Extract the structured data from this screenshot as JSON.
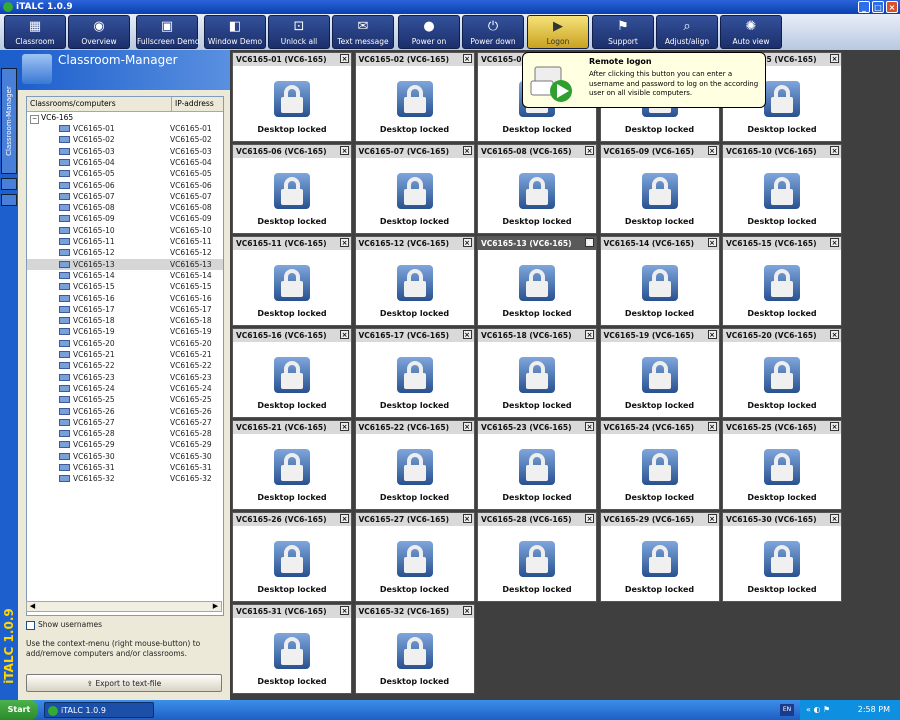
{
  "window": {
    "title": "iTALC 1.0.9"
  },
  "toolbar": {
    "buttons": [
      {
        "label": "Classroom",
        "icon": "classroom-icon",
        "glyph": "▦"
      },
      {
        "label": "Overview",
        "icon": "overview-icon",
        "glyph": "◉"
      },
      {
        "label": "Fullscreen Demo",
        "icon": "fullscreen-demo-icon",
        "glyph": "▣"
      },
      {
        "label": "Window Demo",
        "icon": "window-demo-icon",
        "glyph": "◧"
      },
      {
        "label": "Unlock all",
        "icon": "unlock-icon",
        "glyph": "⊡"
      },
      {
        "label": "Text message",
        "icon": "text-message-icon",
        "glyph": "✉"
      },
      {
        "label": "Power on",
        "icon": "power-on-icon",
        "glyph": "●"
      },
      {
        "label": "Power down",
        "icon": "power-down-icon",
        "glyph": "⏻"
      },
      {
        "label": "Logon",
        "icon": "logon-icon",
        "glyph": "▶"
      },
      {
        "label": "Support",
        "icon": "support-icon",
        "glyph": "⚑"
      },
      {
        "label": "Adjust/align",
        "icon": "adjust-icon",
        "glyph": "⌕"
      },
      {
        "label": "Auto view",
        "icon": "auto-view-icon",
        "glyph": "✺"
      }
    ],
    "active_index": 8
  },
  "leftbar": {
    "tab_label": "Classroom-Manager",
    "logo": "iTALC 1.0.9"
  },
  "panel": {
    "title": "Classroom-Manager",
    "columns": [
      "Classrooms/computers",
      "IP-address"
    ],
    "root": "VC6-165",
    "computers": [
      {
        "name": "VC6165-01",
        "ip": "VC6165-01"
      },
      {
        "name": "VC6165-02",
        "ip": "VC6165-02"
      },
      {
        "name": "VC6165-03",
        "ip": "VC6165-03"
      },
      {
        "name": "VC6165-04",
        "ip": "VC6165-04"
      },
      {
        "name": "VC6165-05",
        "ip": "VC6165-05"
      },
      {
        "name": "VC6165-06",
        "ip": "VC6165-06"
      },
      {
        "name": "VC6165-07",
        "ip": "VC6165-07"
      },
      {
        "name": "VC6165-08",
        "ip": "VC6165-08"
      },
      {
        "name": "VC6165-09",
        "ip": "VC6165-09"
      },
      {
        "name": "VC6165-10",
        "ip": "VC6165-10"
      },
      {
        "name": "VC6165-11",
        "ip": "VC6165-11"
      },
      {
        "name": "VC6165-12",
        "ip": "VC6165-12"
      },
      {
        "name": "VC6165-13",
        "ip": "VC6165-13"
      },
      {
        "name": "VC6165-14",
        "ip": "VC6165-14"
      },
      {
        "name": "VC6165-15",
        "ip": "VC6165-15"
      },
      {
        "name": "VC6165-16",
        "ip": "VC6165-16"
      },
      {
        "name": "VC6165-17",
        "ip": "VC6165-17"
      },
      {
        "name": "VC6165-18",
        "ip": "VC6165-18"
      },
      {
        "name": "VC6165-19",
        "ip": "VC6165-19"
      },
      {
        "name": "VC6165-20",
        "ip": "VC6165-20"
      },
      {
        "name": "VC6165-21",
        "ip": "VC6165-21"
      },
      {
        "name": "VC6165-22",
        "ip": "VC6165-22"
      },
      {
        "name": "VC6165-23",
        "ip": "VC6165-23"
      },
      {
        "name": "VC6165-24",
        "ip": "VC6165-24"
      },
      {
        "name": "VC6165-25",
        "ip": "VC6165-25"
      },
      {
        "name": "VC6165-26",
        "ip": "VC6165-26"
      },
      {
        "name": "VC6165-27",
        "ip": "VC6165-27"
      },
      {
        "name": "VC6165-28",
        "ip": "VC6165-28"
      },
      {
        "name": "VC6165-29",
        "ip": "VC6165-29"
      },
      {
        "name": "VC6165-30",
        "ip": "VC6165-30"
      },
      {
        "name": "VC6165-31",
        "ip": "VC6165-31"
      },
      {
        "name": "VC6165-32",
        "ip": "VC6165-32"
      }
    ],
    "selected_index": 12,
    "show_usernames_label": "Show usernames",
    "hint": "Use the context-menu (right mouse-button) to add/remove computers and/or classrooms.",
    "export_label": "Export to text-file"
  },
  "tiles": {
    "status": "Desktop locked",
    "selected_index": 12,
    "items": [
      "VC6165-01 (VC6-165)",
      "VC6165-02 (VC6-165)",
      "VC6165-03 (VC6-165)",
      "VC6165-04 (VC6-165)",
      "VC6165-05 (VC6-165)",
      "VC6165-06 (VC6-165)",
      "VC6165-07 (VC6-165)",
      "VC6165-08 (VC6-165)",
      "VC6165-09 (VC6-165)",
      "VC6165-10 (VC6-165)",
      "VC6165-11 (VC6-165)",
      "VC6165-12 (VC6-165)",
      "VC6165-13 (VC6-165)",
      "VC6165-14 (VC6-165)",
      "VC6165-15 (VC6-165)",
      "VC6165-16 (VC6-165)",
      "VC6165-17 (VC6-165)",
      "VC6165-18 (VC6-165)",
      "VC6165-19 (VC6-165)",
      "VC6165-20 (VC6-165)",
      "VC6165-21 (VC6-165)",
      "VC6165-22 (VC6-165)",
      "VC6165-23 (VC6-165)",
      "VC6165-24 (VC6-165)",
      "VC6165-25 (VC6-165)",
      "VC6165-26 (VC6-165)",
      "VC6165-27 (VC6-165)",
      "VC6165-28 (VC6-165)",
      "VC6165-29 (VC6-165)",
      "VC6165-30 (VC6-165)",
      "VC6165-31 (VC6-165)",
      "VC6165-32 (VC6-165)"
    ]
  },
  "tooltip": {
    "title": "Remote logon",
    "text": "After clicking this button you can enter a username and password to log on the according user on all visible computers."
  },
  "taskbar": {
    "start": "Start",
    "task": "iTALC 1.0.9",
    "lang": "EN",
    "clock": "2:58 PM"
  }
}
